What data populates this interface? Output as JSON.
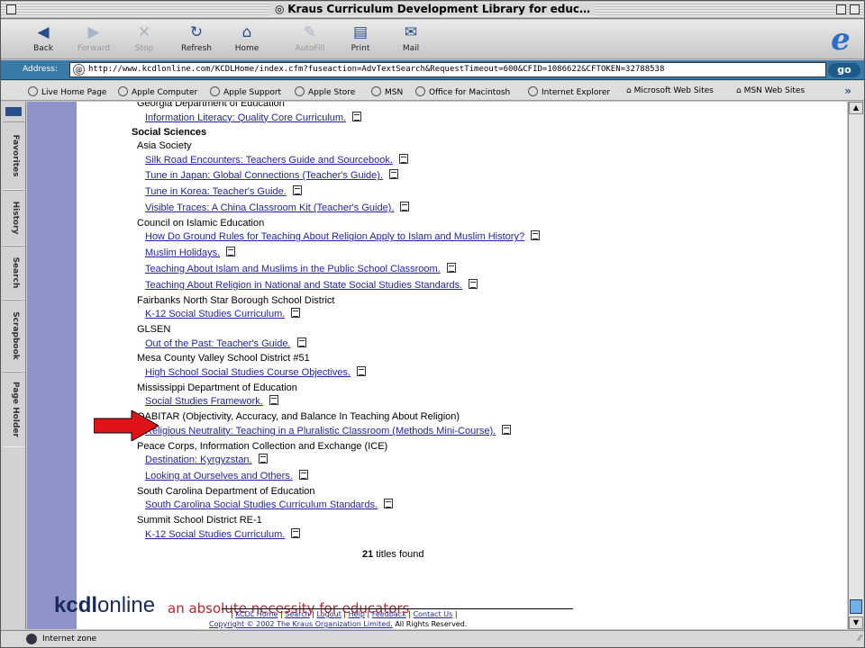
{
  "window": {
    "title": "Kraus Curriculum Development Library for educ…"
  },
  "toolbar": {
    "buttons": [
      {
        "label": "Back",
        "icon": "back-arrow-icon"
      },
      {
        "label": "Forward",
        "icon": "forward-arrow-icon"
      },
      {
        "label": "Stop",
        "icon": "stop-icon"
      },
      {
        "label": "Refresh",
        "icon": "refresh-icon"
      },
      {
        "label": "Home",
        "icon": "home-icon"
      },
      {
        "label": "AutoFill",
        "icon": "autofill-icon"
      },
      {
        "label": "Print",
        "icon": "print-icon"
      },
      {
        "label": "Mail",
        "icon": "mail-icon"
      }
    ]
  },
  "address": {
    "label": "Address:",
    "url": "http://www.kcdlonline.com/KCDLHome/index.cfm?fuseaction=AdvTextSearch&RequestTimeout=600&CFID=1086622&CFTOKEN=32788538",
    "go": "go"
  },
  "favorites": [
    "Live Home Page",
    "Apple Computer",
    "Apple Support",
    "Apple Store",
    "MSN",
    "Office for Macintosh",
    "Internet Explorer",
    "Microsoft Web Sites",
    "MSN Web Sites"
  ],
  "sidebar_tabs": [
    "Favorites",
    "History",
    "Search",
    "Scrapbook",
    "Page Holder"
  ],
  "results": [
    {
      "kind": "org",
      "text": "Georgia Department of Education"
    },
    {
      "kind": "link",
      "text": "Information Literacy: Quality Core Curriculum."
    },
    {
      "kind": "cat",
      "text": "Social Sciences"
    },
    {
      "kind": "org",
      "text": "Asia Society"
    },
    {
      "kind": "link",
      "text": "Silk Road Encounters: Teachers Guide and Sourcebook."
    },
    {
      "kind": "link",
      "text": "Tune in Japan: Global Connections (Teacher's Guide)."
    },
    {
      "kind": "link",
      "text": "Tune in Korea: Teacher's Guide."
    },
    {
      "kind": "link",
      "text": "Visible Traces: A China Classroom Kit (Teacher's Guide)."
    },
    {
      "kind": "org",
      "text": "Council on Islamic Education"
    },
    {
      "kind": "link",
      "text": "How Do Ground Rules for Teaching About Religion Apply to Islam and Muslim History?"
    },
    {
      "kind": "link",
      "text": "Muslim Holidays."
    },
    {
      "kind": "link",
      "text": "Teaching About Islam and Muslims in the Public School Classroom."
    },
    {
      "kind": "link",
      "text": "Teaching About Religion in National and State Social Studies Standards."
    },
    {
      "kind": "org",
      "text": "Fairbanks North Star Borough School District"
    },
    {
      "kind": "link",
      "text": "K-12 Social Studies Curriculum."
    },
    {
      "kind": "org",
      "text": "GLSEN"
    },
    {
      "kind": "link",
      "text": "Out of the Past: Teacher's Guide."
    },
    {
      "kind": "org",
      "text": "Mesa County Valley School District #51"
    },
    {
      "kind": "link",
      "text": "High School Social Studies Course Objectives."
    },
    {
      "kind": "org",
      "text": "Mississippi Department of Education"
    },
    {
      "kind": "link",
      "text": "Social Studies Framework."
    },
    {
      "kind": "org",
      "text": "OABITAR (Objectivity, Accuracy, and Balance In Teaching About Religion)"
    },
    {
      "kind": "link",
      "text": "Religious Neutrality: Teaching in a Pluralistic Classroom (Methods Mini-Course)."
    },
    {
      "kind": "org",
      "text": "Peace Corps, Information Collection and Exchange (ICE)"
    },
    {
      "kind": "link",
      "text": "Destination: Kyrgyzstan."
    },
    {
      "kind": "link",
      "text": "Looking at Ourselves and Others."
    },
    {
      "kind": "org",
      "text": "South Carolina Department of Education"
    },
    {
      "kind": "link",
      "text": "South Carolina Social Studies Curriculum Standards."
    },
    {
      "kind": "org",
      "text": "Summit School District RE-1"
    },
    {
      "kind": "link",
      "text": "K-12 Social Studies Curriculum."
    }
  ],
  "summary": {
    "count": "21",
    "suffix": " titles found"
  },
  "footer": {
    "logo_bold": "kcdl",
    "logo_rest": "online",
    "tagline": "an absolute necessity for educators",
    "links": [
      "KCDL Home",
      "Search",
      "Logout",
      "Help",
      "Feedback",
      "Contact Us"
    ],
    "copyright_link": "Copyright © 2002 The Kraus Organization Limited.",
    "copyright_rest": " All Rights Reserved."
  },
  "status": {
    "text": "Internet zone"
  },
  "colors": {
    "sidebar_band": "#8e93c8",
    "link": "#2222aa",
    "arrow": "#e0131b",
    "address_bar": "#3a7aa6"
  }
}
